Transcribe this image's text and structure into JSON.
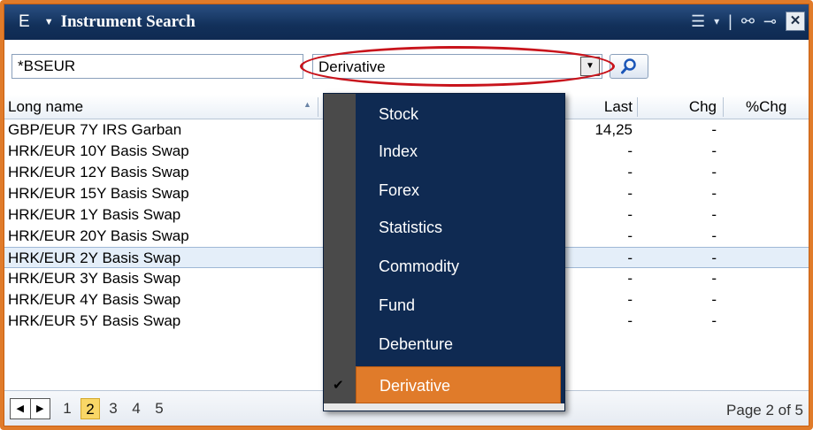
{
  "window": {
    "title_badge": "E",
    "title_arrow": "▼",
    "title": "Instrument Search",
    "icons": {
      "list_menu": "☰",
      "dropdown": "▾",
      "separator": "|",
      "link": "⚯",
      "pin": "⊸",
      "close": "✕"
    }
  },
  "search": {
    "query": "*BSEUR",
    "type_selected": "Derivative",
    "type_dropdown_arrow": "▼"
  },
  "table": {
    "columns": {
      "long_name": "Long name",
      "last": "Last",
      "chg": "Chg",
      "pct_chg": "%Chg"
    },
    "sort_indicator": "▲",
    "rows": [
      {
        "name": "GBP/EUR 7Y IRS Garban",
        "last": "14,25",
        "chg": "-"
      },
      {
        "name": "HRK/EUR 10Y Basis Swap",
        "last": "-",
        "chg": "-"
      },
      {
        "name": "HRK/EUR 12Y Basis Swap",
        "last": "-",
        "chg": "-"
      },
      {
        "name": "HRK/EUR 15Y Basis Swap",
        "last": "-",
        "chg": "-"
      },
      {
        "name": "HRK/EUR 1Y Basis Swap",
        "last": "-",
        "chg": "-"
      },
      {
        "name": "HRK/EUR 20Y Basis Swap",
        "last": "-",
        "chg": "-"
      },
      {
        "name": "HRK/EUR 2Y Basis Swap",
        "last": "-",
        "chg": "-"
      },
      {
        "name": "HRK/EUR 3Y Basis Swap",
        "last": "-",
        "chg": "-"
      },
      {
        "name": "HRK/EUR 4Y Basis Swap",
        "last": "-",
        "chg": "-"
      },
      {
        "name": "HRK/EUR 5Y Basis Swap",
        "last": "-",
        "chg": "-"
      }
    ],
    "selected_row": 6
  },
  "menu": {
    "items": [
      "Stock",
      "Index",
      "Forex",
      "Statistics",
      "Commodity",
      "Fund",
      "Debenture",
      "Derivative"
    ],
    "checked": "Derivative",
    "check_mark": "✔"
  },
  "pager": {
    "prev": "◀",
    "next": "▶",
    "pages": [
      "1",
      "2",
      "3",
      "4",
      "5"
    ],
    "current": "2",
    "info": "Page 2 of 5"
  },
  "colors": {
    "frame": "#e07b2a",
    "titlebar": "#12305a",
    "menu_bg": "#0f2a52",
    "menu_active": "#e07b2a",
    "highlight": "#c8141c"
  }
}
